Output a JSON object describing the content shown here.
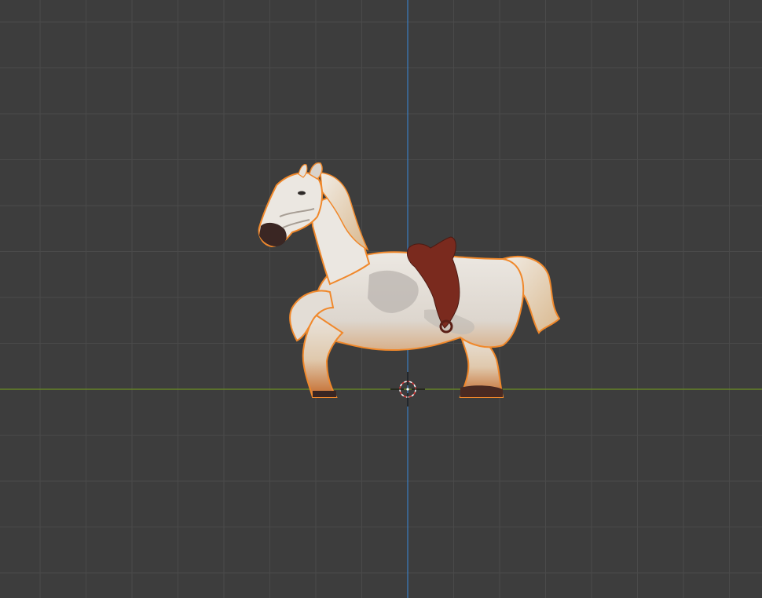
{
  "app": {
    "view_type": "3D Viewport",
    "background_color": "#3d3d3d",
    "grid_color": "#4a4a4a",
    "x_axis_color": "#6b8e23",
    "z_axis_color": "#3a7dc0",
    "selection_outline_color": "#f0882b"
  },
  "scene": {
    "selected_object_icon": "horse-model",
    "cursor_icon": "3d-cursor-icon",
    "saddle_color": "#7a2a1e",
    "horse_body_color": "#e6e2dc",
    "horse_shading_color": "#b9b3ad",
    "hoof_gradient_color": "#c46a2b",
    "muzzle_color": "#3a2623"
  }
}
